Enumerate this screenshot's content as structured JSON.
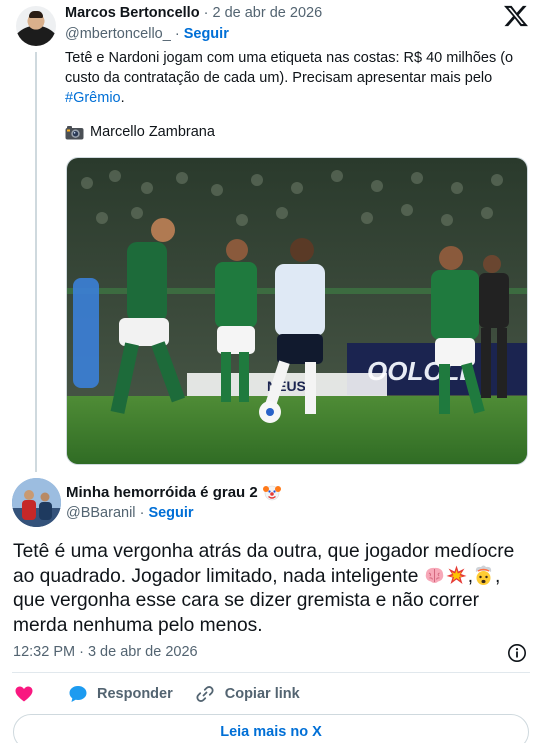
{
  "quoted_tweet": {
    "author_name": "Marcos Bertoncello",
    "separator": "·",
    "date": "2 de abr de 2026",
    "handle": "@mbertoncello_",
    "follow_label": "Seguir",
    "text_main": "Tetê e Nardoni jogam com uma etiqueta nas costas: R$ 40 milhões (o custo da contratação de cada um). Precisam apresentar mais pelo ",
    "hashtag": "#Grêmio",
    "text_end": ".",
    "photo_credit": "Marcello Zambrana",
    "photo_credit_icon": "camera-emoji",
    "media_description_icon": "football-match-photo"
  },
  "reply_tweet": {
    "author_name": "Minha hemorróida é grau 2",
    "name_emoji": "clown-face-emoji",
    "separator": "·",
    "handle": "@BBaranil",
    "follow_label": "Seguir",
    "text_line1": "Tetê é uma vergonha atrás da outra, que jogador medíocre ao quadrado. Jogador limitado, nada inteligente ",
    "text_sep1": ",",
    "text_line2": ", que vergonha esse cara se dizer gremista e não correr merda nenhuma pelo menos.",
    "inline_emojis": [
      "brain-emoji",
      "collision-emoji",
      "exploding-head-emoji"
    ],
    "timestamp": "12:32 PM · 3 de abr de 2026"
  },
  "actions": {
    "like_icon": "heart-icon",
    "reply_label": "Responder",
    "copy_link_label": "Copiar link"
  },
  "read_more_label": "Leia mais no X",
  "colors": {
    "link_blue": "#006fd6",
    "text_primary": "#0f1419",
    "text_secondary": "#536471",
    "like_pink": "#f91880",
    "reply_blue": "#1d9bf0",
    "pitch_green": "#3f7d2e"
  }
}
